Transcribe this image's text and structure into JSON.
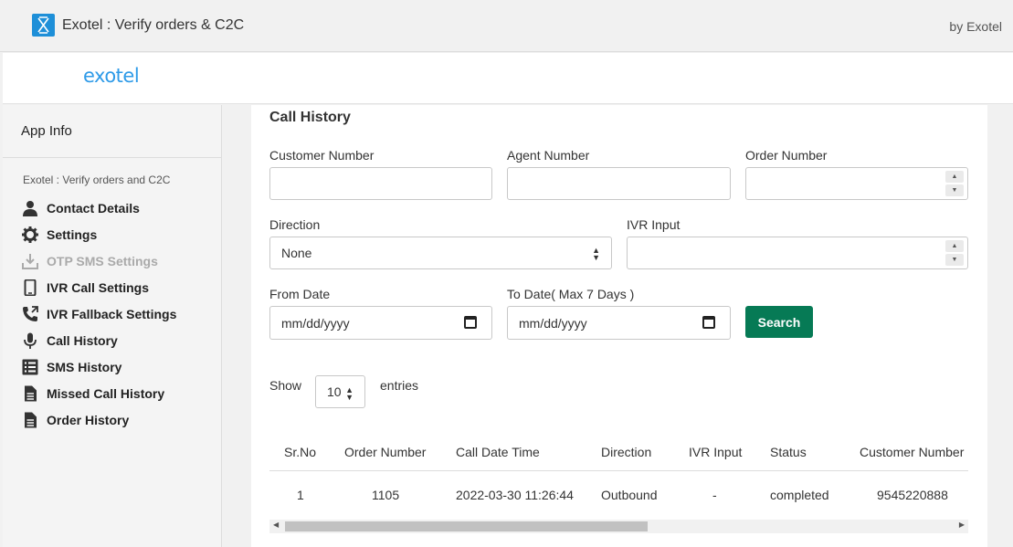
{
  "app": {
    "title": "Exotel : Verify orders & C2C",
    "by": "by Exotel",
    "brand": "exotel"
  },
  "sidebar": {
    "app_info": "App Info",
    "caption": "Exotel : Verify orders and C2C",
    "items": [
      {
        "label": "Contact Details",
        "icon": "user-icon",
        "disabled": false
      },
      {
        "label": "Settings",
        "icon": "gear-icon",
        "disabled": false
      },
      {
        "label": "OTP SMS Settings",
        "icon": "download-icon",
        "disabled": true
      },
      {
        "label": "IVR Call Settings",
        "icon": "mobile-icon",
        "disabled": false
      },
      {
        "label": "IVR Fallback Settings",
        "icon": "phone-forward-icon",
        "disabled": false
      },
      {
        "label": "Call History",
        "icon": "microphone-icon",
        "disabled": false
      },
      {
        "label": "SMS History",
        "icon": "list-icon",
        "disabled": false
      },
      {
        "label": "Missed Call History",
        "icon": "document-icon",
        "disabled": false
      },
      {
        "label": "Order History",
        "icon": "document-icon",
        "disabled": false
      }
    ]
  },
  "main": {
    "title": "Call History",
    "filters": {
      "customer_number_label": "Customer Number",
      "agent_number_label": "Agent Number",
      "order_number_label": "Order Number",
      "direction_label": "Direction",
      "direction_value": "None",
      "ivr_input_label": "IVR Input",
      "from_date_label": "From Date",
      "from_date_placeholder": "mm/dd/yyyy",
      "to_date_label": "To Date( Max 7 Days )",
      "to_date_placeholder": "mm/dd/yyyy",
      "search_label": "Search"
    },
    "entries": {
      "show_label": "Show",
      "value": "10",
      "entries_label": "entries"
    },
    "table": {
      "headers": [
        "Sr.No",
        "Order Number",
        "Call Date Time",
        "Direction",
        "IVR Input",
        "Status",
        "Customer Number"
      ],
      "rows": [
        [
          "1",
          "1105",
          "2022-03-30 11:26:44",
          "Outbound",
          "-",
          "completed",
          "9545220888"
        ]
      ]
    }
  },
  "colors": {
    "accent": "#067a55",
    "brand": "#2f9be8"
  }
}
